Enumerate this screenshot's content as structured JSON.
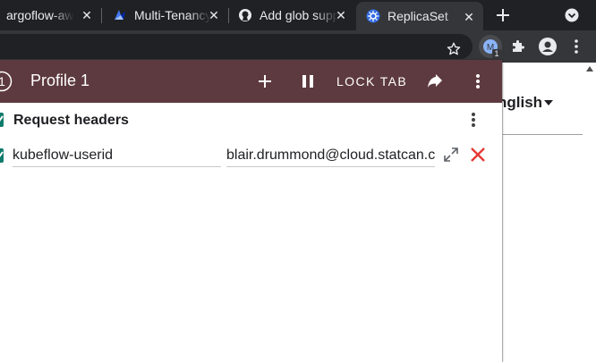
{
  "browser": {
    "tabs": [
      {
        "title": "argoflow-aws",
        "favicon": "none",
        "active": false
      },
      {
        "title": "Multi-Tenancy",
        "favicon": "kubeflow-icon",
        "active": false
      },
      {
        "title": "Add glob support",
        "favicon": "github-icon",
        "active": false
      },
      {
        "title": "ReplicaSet",
        "favicon": "kubernetes-icon",
        "active": true
      }
    ],
    "extension_badge": "1"
  },
  "page": {
    "language_label": "nglish"
  },
  "modheader": {
    "profile_number": "1",
    "profile_title": "Profile 1",
    "lock_tab_label": "LOCK TAB",
    "section_title": "Request headers",
    "headers": [
      {
        "name": "kubeflow-userid",
        "value": "blair.drummond@cloud.statcan.ca",
        "enabled": true
      }
    ],
    "colors": {
      "header_bg": "#5d3a3f",
      "checkbox": "#0f7b6c",
      "delete": "#e53935"
    }
  }
}
